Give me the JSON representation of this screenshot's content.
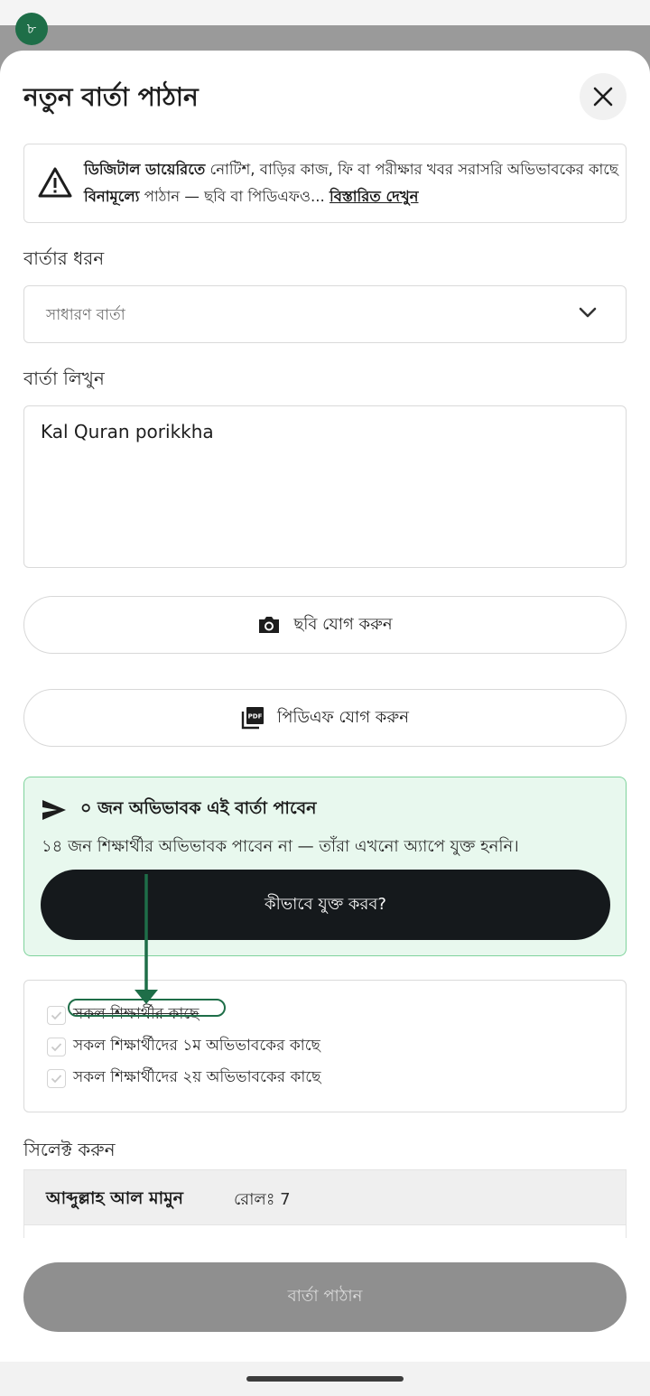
{
  "step_badge": "৮",
  "sheet": {
    "title": "নতুন বার্তা পাঠান",
    "close_icon": "close-icon"
  },
  "notice": {
    "icon": "warning-triangle-icon",
    "bold_1": "ডিজিটাল ডায়েরিতে",
    "text_1": " নোটিশ, বাড়ির কাজ, ফি বা পরীক্ষার খবর সরাসরি অভিভাবকের কাছে ",
    "bold_2": "বিনামূল্যে",
    "text_2": " পাঠান — ছবি বা পিডিএফও...",
    "more_link": "বিস্তারিত দেখুন"
  },
  "message_type": {
    "label": "বার্তার ধরন",
    "selected": "সাধারণ বার্তা"
  },
  "message_body": {
    "label": "বার্তা লিখুন",
    "value": "Kal Quran porikkha"
  },
  "attachments": {
    "photo_label": "ছবি যোগ করুন",
    "pdf_label": "পিডিএফ যোগ করুন"
  },
  "recipients_info": {
    "headline": "০ জন অভিভাবক এই বার্তা পাবেন",
    "subtext": "১৪ জন শিক্ষার্থীর অভিভাবক পাবেন না — তাঁরা এখনো অ্যাপে যুক্ত হননি।",
    "button_label": "কীভাবে যুক্ত করব?"
  },
  "recipient_options": [
    {
      "label": "সকল শিক্ষার্থীর কাছে",
      "checked": true
    },
    {
      "label": "সকল শিক্ষার্থীদের ১ম অভিভাবকের কাছে",
      "checked": true
    },
    {
      "label": "সকল শিক্ষার্থীদের ২য় অভিভাবকের কাছে",
      "checked": true
    }
  ],
  "select_section": {
    "label": "সিলেক্ট করুন",
    "students": [
      {
        "name": "আব্দুল্লাহ আল মামুন",
        "roll": "রোলঃ 7"
      }
    ]
  },
  "submit_label": "বার্তা পাঠান",
  "colors": {
    "accent_green": "#1e6e48",
    "info_bg": "#e8f8ee",
    "info_border": "#7fd39c",
    "dark_button": "#15191c",
    "disabled_button": "#8f8f8f"
  }
}
